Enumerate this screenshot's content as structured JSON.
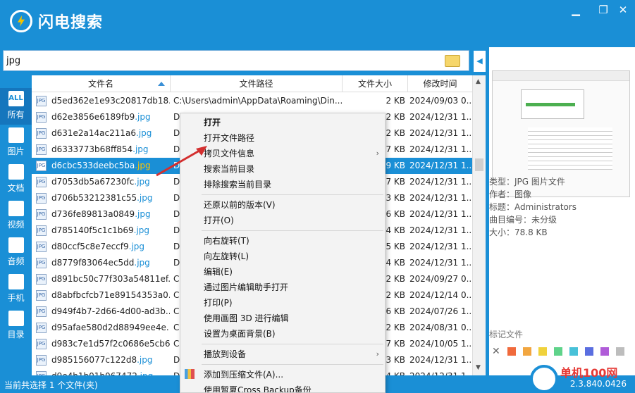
{
  "app": {
    "title": "闪电搜索"
  },
  "window": {
    "minimize": "▁",
    "maximize": "❐",
    "close": "✕"
  },
  "search": {
    "value": "jpg",
    "collapse_icon": "◀"
  },
  "sidebar": {
    "items": [
      {
        "icon_text": "ALL",
        "label": "所有"
      },
      {
        "icon_text": "",
        "label": "图片"
      },
      {
        "icon_text": "",
        "label": "文档"
      },
      {
        "icon_text": "",
        "label": "视频"
      },
      {
        "icon_text": "",
        "label": "音频"
      },
      {
        "icon_text": "",
        "label": "手机"
      },
      {
        "icon_text": "",
        "label": "目录"
      }
    ]
  },
  "table": {
    "columns": [
      "文件名",
      "文件路径",
      "文件大小",
      "修改时间"
    ],
    "rows": [
      {
        "name": "d5ed362e1e93c20817db18...",
        "ext": "",
        "path": "C:\\Users\\admin\\AppData\\Roaming\\Din...",
        "size": "2 KB",
        "date": "2024/09/03 0..."
      },
      {
        "name": "d62e3856e6189fb9",
        "ext": ".jpg",
        "path": "D",
        "size": "2 KB",
        "date": "2024/12/31 1..."
      },
      {
        "name": "d631e2a14ac211a6",
        "ext": ".jpg",
        "path": "D",
        "size": "2 KB",
        "date": "2024/12/31 1..."
      },
      {
        "name": "d6333773b68ff854",
        "ext": ".jpg",
        "path": "D",
        "size": "7 KB",
        "date": "2024/12/31 1..."
      },
      {
        "name": "d6cbc533deebc5ba",
        "ext": ".jpg",
        "path": "D",
        "size": "9 KB",
        "date": "2024/12/31 1..."
      },
      {
        "name": "d7053db5a67230fc",
        "ext": ".jpg",
        "path": "D",
        "size": "7 KB",
        "date": "2024/12/31 1..."
      },
      {
        "name": "d706b53212381c55",
        "ext": ".jpg",
        "path": "D",
        "size": "3 KB",
        "date": "2024/12/31 1..."
      },
      {
        "name": "d736fe89813a0849",
        "ext": ".jpg",
        "path": "D",
        "size": "6 KB",
        "date": "2024/12/31 1..."
      },
      {
        "name": "d785140f5c1c1b69",
        "ext": ".jpg",
        "path": "D",
        "size": "4 KB",
        "date": "2024/12/31 1..."
      },
      {
        "name": "d80ccf5c8e7eccf9",
        "ext": ".jpg",
        "path": "D",
        "size": "5 KB",
        "date": "2024/12/31 1..."
      },
      {
        "name": "d8779f83064ec5dd",
        "ext": ".jpg",
        "path": "D",
        "size": "4 KB",
        "date": "2024/12/31 1..."
      },
      {
        "name": "d891bc50c77f303a54811ef...",
        "ext": "",
        "path": "C",
        "size": "2 KB",
        "date": "2024/09/27 0..."
      },
      {
        "name": "d8abfbcfcb71e89154353a0...",
        "ext": "",
        "path": "C",
        "size": "2 KB",
        "date": "2024/12/14 0..."
      },
      {
        "name": "d949f4b7-2d66-4d00-ad3b...",
        "ext": "",
        "path": "C",
        "size": "6 KB",
        "date": "2024/07/26 1..."
      },
      {
        "name": "d95afae580d2d88949ee4e...",
        "ext": "",
        "path": "C",
        "size": "2 KB",
        "date": "2024/08/31 0..."
      },
      {
        "name": "d983c7e1d57f2c0686e5cb6...",
        "ext": "",
        "path": "C",
        "size": "7 KB",
        "date": "2024/10/05 1..."
      },
      {
        "name": "d985156077c122d8",
        "ext": ".jpg",
        "path": "D",
        "size": "3 KB",
        "date": "2024/12/31 1..."
      },
      {
        "name": "d9e4b1b01b067472",
        "ext": ".jpg",
        "path": "D",
        "size": "4 KB",
        "date": "2024/12/31 1..."
      }
    ],
    "selected_index": 4
  },
  "preview": {
    "type_label": "类型：JPG 图片文件",
    "author_label": "作者：图像",
    "title_label": "标题：Administrators",
    "track_label": "曲目编号：未分级",
    "size_label": "大小：78.8 KB",
    "tags_label": "标记文件",
    "tag_colors": [
      "#666666",
      "#f06a3c",
      "#f2a640",
      "#f0d23c",
      "#5fd38a",
      "#48c1d8",
      "#5a6ee0",
      "#b05cd8",
      "#bdbdbd"
    ]
  },
  "status": {
    "text": "当前共选择 1 个文件(夹)",
    "version": "2.3.840.0426"
  },
  "watermark": {
    "text": "单机100网"
  },
  "context_menu": {
    "items": [
      {
        "label": "打开",
        "bold": true
      },
      {
        "label": "打开文件路径"
      },
      {
        "label": "拷贝文件信息",
        "submenu": true
      },
      {
        "label": "搜索当前目录"
      },
      {
        "label": "排除搜索当前目录"
      },
      {
        "sep": true
      },
      {
        "label": "还原以前的版本(V)"
      },
      {
        "label": "打开(O)"
      },
      {
        "sep": true
      },
      {
        "label": "向右旋转(T)"
      },
      {
        "label": "向左旋转(L)"
      },
      {
        "label": "编辑(E)"
      },
      {
        "label": "通过图片编辑助手打开"
      },
      {
        "label": "打印(P)"
      },
      {
        "label": "使用画图 3D 进行编辑"
      },
      {
        "label": "设置为桌面背景(B)"
      },
      {
        "sep": true
      },
      {
        "label": "播放到设备",
        "submenu": true
      },
      {
        "sep": true
      },
      {
        "label": "添加到压缩文件(A)...",
        "zip": true
      },
      {
        "label": "使用暂夏Cross Backup备份"
      }
    ]
  }
}
